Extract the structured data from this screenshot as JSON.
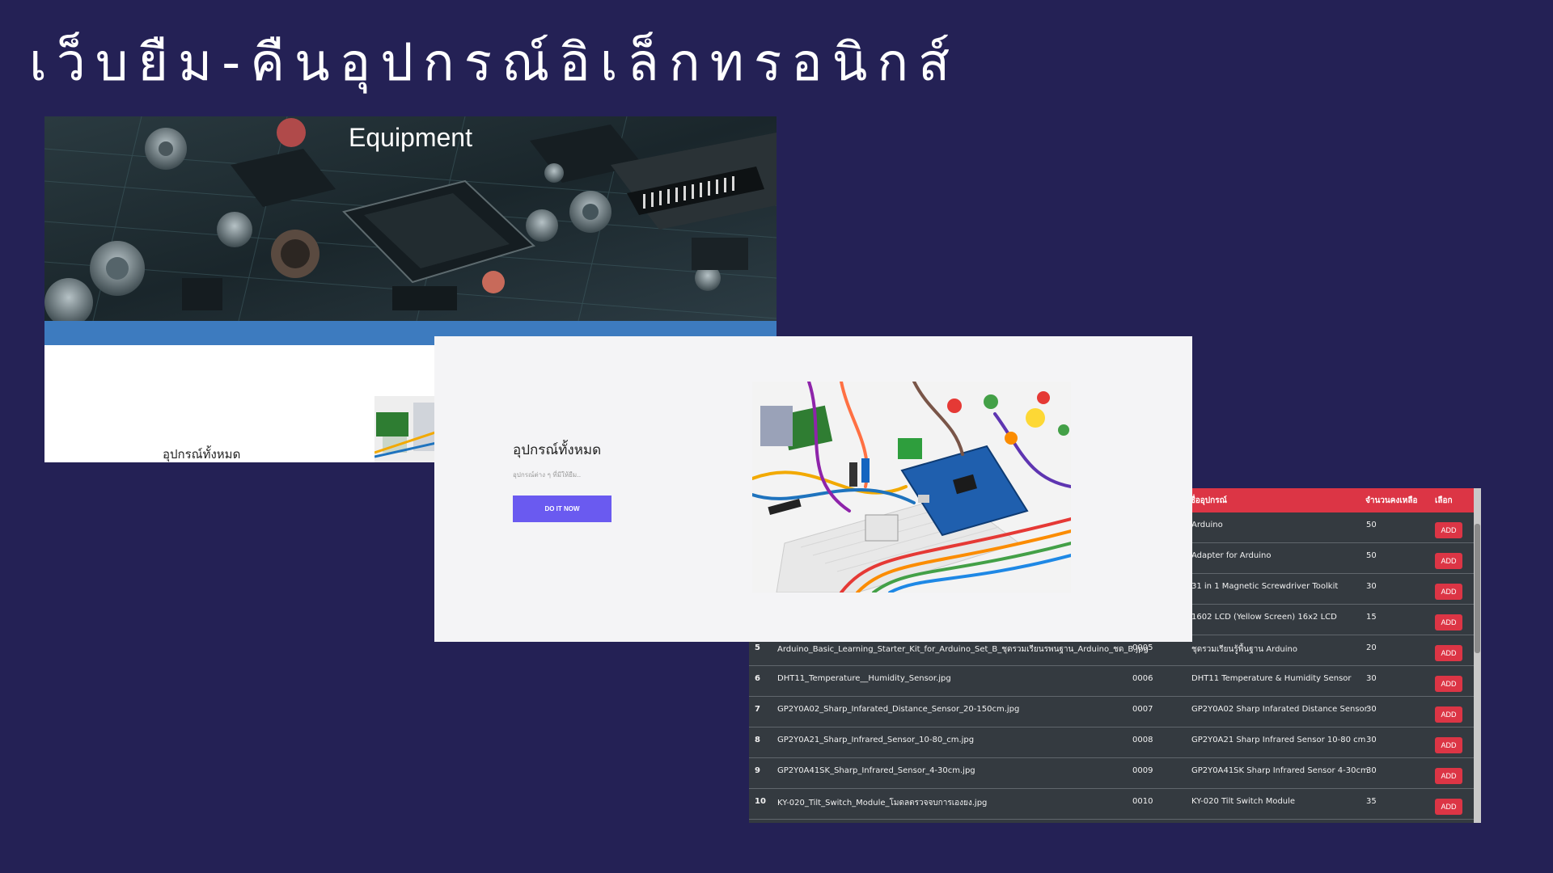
{
  "slide": {
    "title": "เว็บยืม-คืนอุปกรณ์อิเล็กทรอนิกส์",
    "background_color": "#242155"
  },
  "equipment_page": {
    "banner_title": "Equipment",
    "heading": "อุปกรณ์ทั้งหมด",
    "strip_color": "#3d7bbf"
  },
  "hero_page": {
    "title": "อุปกรณ์ทั้งหมด",
    "subtitle": "อุปกรณ์ต่าง ๆ ที่มีให้ยืม..",
    "button_label": "DO IT NOW",
    "button_color": "#6a5af0",
    "image_icon": "arduino-kit-photo"
  },
  "table_page": {
    "columns": [
      "ชื่ออุปกรณ์",
      "จำนวนคงเหลือ",
      "เลือก"
    ],
    "header_color": "#dc3545",
    "add_label": "ADD",
    "rows": [
      {
        "no": "",
        "file": "",
        "code": "",
        "name": "Arduino",
        "qty": "50"
      },
      {
        "no": "",
        "file": "",
        "code": "",
        "name": "Adapter for Arduino",
        "qty": "50"
      },
      {
        "no": "",
        "file": "",
        "code": "",
        "name": "31 in 1 Magnetic Screwdriver Toolkit",
        "qty": "30"
      },
      {
        "no": "",
        "file": "",
        "code": "",
        "name": "1602 LCD (Yellow Screen) 16x2 LCD",
        "qty": "15"
      },
      {
        "no": "5",
        "file": "Arduino_Basic_Learning_Starter_Kit_for_Arduino_Set_B_ชุดรวมเรียนรพนฐาน_Arduino_ชด_B.jpg",
        "code": "0005",
        "name": "ชุดรวมเรียนรู้พื้นฐาน Arduino",
        "qty": "20"
      },
      {
        "no": "6",
        "file": "DHT11_Temperature__Humidity_Sensor.jpg",
        "code": "0006",
        "name": "DHT11 Temperature & Humidity Sensor",
        "qty": "30"
      },
      {
        "no": "7",
        "file": "GP2Y0A02_Sharp_Infarated_Distance_Sensor_20-150cm.jpg",
        "code": "0007",
        "name": "GP2Y0A02 Sharp Infarated Distance Sensor",
        "qty": "30"
      },
      {
        "no": "8",
        "file": "GP2Y0A21_Sharp_Infrared_Sensor_10-80_cm.jpg",
        "code": "0008",
        "name": "GP2Y0A21 Sharp Infrared Sensor 10-80 cm",
        "qty": "30"
      },
      {
        "no": "9",
        "file": "GP2Y0A41SK_Sharp_Infrared_Sensor_4-30cm.jpg",
        "code": "0009",
        "name": "GP2Y0A41SK Sharp Infrared Sensor 4-30cm",
        "qty": "30"
      },
      {
        "no": "10",
        "file": "KY-020_Tilt_Switch_Module_โมดลตรวจจบการเองยง.jpg",
        "code": "0010",
        "name": "KY-020 Tilt Switch Module",
        "qty": "35"
      }
    ]
  }
}
